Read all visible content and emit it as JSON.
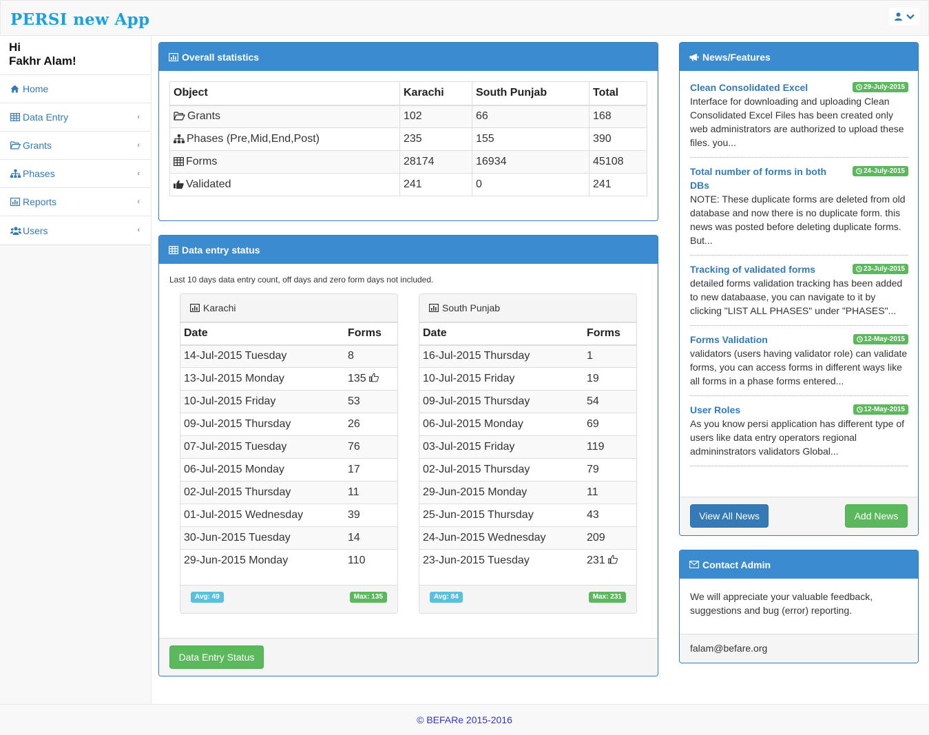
{
  "app": {
    "title": "PERSI new App"
  },
  "sidebar": {
    "greeting": "Hi",
    "user_name": "Fakhr Alam!",
    "items": [
      {
        "label": "Home",
        "icon": "home-icon"
      },
      {
        "label": "Data Entry",
        "icon": "table-icon"
      },
      {
        "label": "Grants",
        "icon": "folder-open-icon"
      },
      {
        "label": "Phases",
        "icon": "sitemap-icon"
      },
      {
        "label": "Reports",
        "icon": "bar-chart-icon"
      },
      {
        "label": "Users",
        "icon": "users-icon"
      }
    ]
  },
  "overall": {
    "title": "Overall statistics",
    "headers": [
      "Object",
      "Karachi",
      "South Punjab",
      "Total"
    ],
    "rows": [
      {
        "name": "Grants",
        "icon": "folder-open-icon",
        "karachi": "102",
        "punjab": "66",
        "total": "168"
      },
      {
        "name": "Phases (Pre,Mid,End,Post)",
        "icon": "sitemap-icon",
        "karachi": "235",
        "punjab": "155",
        "total": "390"
      },
      {
        "name": "Forms",
        "icon": "table-icon",
        "karachi": "28174",
        "punjab": "16934",
        "total": "45108"
      },
      {
        "name": "Validated",
        "icon": "thumbs-up-icon",
        "karachi": "241",
        "punjab": "0",
        "total": "241"
      }
    ]
  },
  "data_entry": {
    "title": "Data entry status",
    "note": "Last 10 days data entry count, off days and zero form days not included.",
    "button": "Data Entry Status",
    "karachi": {
      "title": "Karachi",
      "headers": [
        "Date",
        "Forms"
      ],
      "rows": [
        [
          "14-Jul-2015 Tuesday",
          "8"
        ],
        [
          "13-Jul-2015 Monday",
          "135"
        ],
        [
          "10-Jul-2015 Friday",
          "53"
        ],
        [
          "09-Jul-2015 Thursday",
          "26"
        ],
        [
          "07-Jul-2015 Tuesday",
          "76"
        ],
        [
          "06-Jul-2015 Monday",
          "17"
        ],
        [
          "02-Jul-2015 Thursday",
          "11"
        ],
        [
          "01-Jul-2015 Wednesday",
          "39"
        ],
        [
          "30-Jun-2015 Tuesday",
          "14"
        ],
        [
          "29-Jun-2015 Monday",
          "110"
        ]
      ],
      "avg": "Avg: 49",
      "max": "Max: 135"
    },
    "punjab": {
      "title": "South Punjab",
      "headers": [
        "Date",
        "Forms"
      ],
      "rows": [
        [
          "16-Jul-2015 Thursday",
          "1"
        ],
        [
          "10-Jul-2015 Friday",
          "19"
        ],
        [
          "09-Jul-2015 Thursday",
          "54"
        ],
        [
          "06-Jul-2015 Monday",
          "69"
        ],
        [
          "03-Jul-2015 Friday",
          "119"
        ],
        [
          "02-Jul-2015 Thursday",
          "79"
        ],
        [
          "29-Jun-2015 Monday",
          "11"
        ],
        [
          "25-Jun-2015 Thursday",
          "43"
        ],
        [
          "24-Jun-2015 Wednesday",
          "209"
        ],
        [
          "23-Jun-2015 Tuesday",
          "231"
        ]
      ],
      "avg": "Avg: 84",
      "max": "Max: 231"
    }
  },
  "news": {
    "title": "News/Features",
    "items": [
      {
        "title": "Clean Consolidated Excel",
        "date": "29-July-2015",
        "body": "Interface for downloading and uploading Clean Consolidated Excel Files has been created only web administrators are authorized to upload these files. you..."
      },
      {
        "title": "Total number of forms in both DBs",
        "date": "24-July-2015",
        "body": "NOTE: These duplicate forms are deleted from old database and now there is no duplicate form. this news was posted before deleting duplicate forms. But..."
      },
      {
        "title": "Tracking of validated forms",
        "date": "23-July-2015",
        "body": "detailed forms validation tracking has been added to new databaase, you can navigate to it by clicking \"LIST ALL PHASES\" under \"PHASES\"..."
      },
      {
        "title": "Forms Validation",
        "date": "12-May-2015",
        "body": "validators (users having validator role) can validate forms, you can access forms in different ways like all forms in a phase forms entered..."
      },
      {
        "title": "User Roles",
        "date": "12-May-2015",
        "body": "As you know persi application has different type of users like data entry operators regional admininstrators validators Global..."
      }
    ],
    "view_all": "View All News",
    "add": "Add News"
  },
  "contact": {
    "title": "Contact Admin",
    "body": "We will appreciate your valuable feedback, suggestions and bug (error) reporting.",
    "email": "falam@befare.org"
  },
  "footer": {
    "text": "© BEFARe 2015-2016"
  },
  "colors": {
    "brand": "#1ba1e2",
    "panel_heading": "#3a8bd0",
    "primary": "#337ab7",
    "success": "#5cb85c",
    "info": "#5bc0de"
  }
}
